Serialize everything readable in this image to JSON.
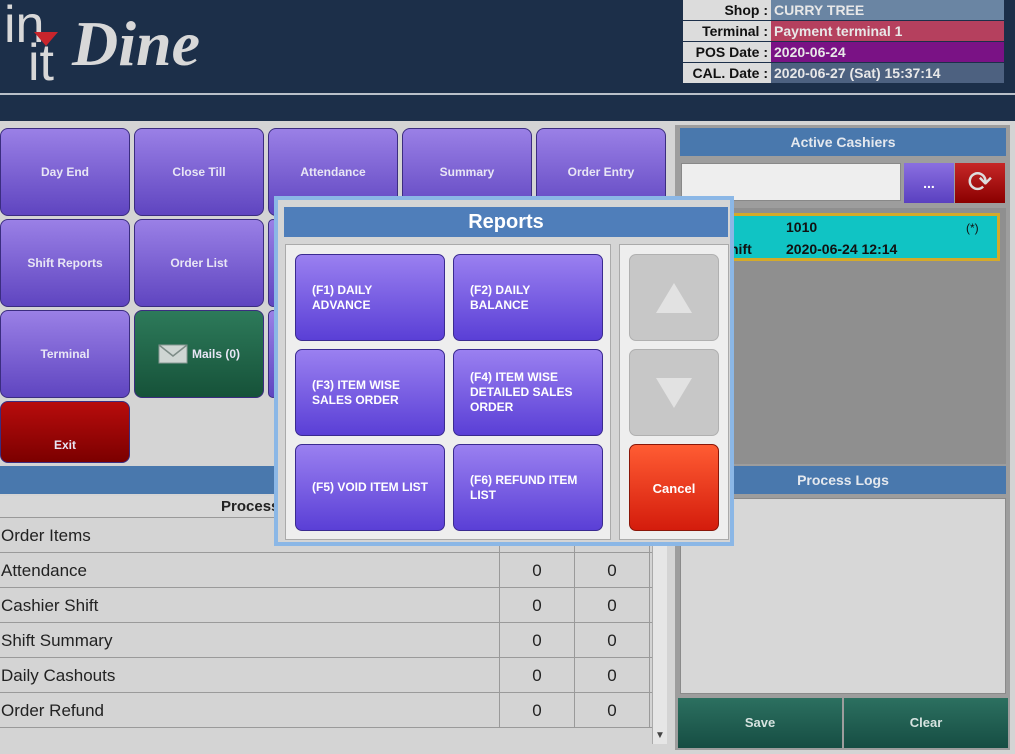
{
  "logo": {
    "in": "in",
    "it": "it",
    "dine": "Dine"
  },
  "info": {
    "shop_label": "Shop :",
    "shop_value": "CURRY TREE",
    "terminal_label": "Terminal :",
    "terminal_value": "Payment terminal 1",
    "posdate_label": "POS Date :",
    "posdate_value": "2020-06-24",
    "caldate_label": "CAL. Date :",
    "caldate_value": "2020-06-27 (Sat) 15:37:14",
    "colors": {
      "shop": "#6a85a3",
      "terminal": "#b5405e",
      "posdate": "#7a1285",
      "caldate": "#4d6180"
    }
  },
  "tiles": {
    "day_end": "Day End",
    "close_till": "Close Till",
    "attendance": "Attendance",
    "summary": "Summary",
    "order_entry": "Order Entry",
    "shift_reports": "Shift Reports",
    "order_list": "Order List",
    "terminal": "Terminal",
    "mails": "Mails (0)",
    "exit": "Exit"
  },
  "table": {
    "header": "Process",
    "rows": [
      {
        "name": "Order Items",
        "a": "",
        "b": ""
      },
      {
        "name": "Attendance",
        "a": "0",
        "b": "0"
      },
      {
        "name": "Cashier Shift",
        "a": "0",
        "b": "0"
      },
      {
        "name": "Shift Summary",
        "a": "0",
        "b": "0"
      },
      {
        "name": "Daily Cashouts",
        "a": "0",
        "b": "0"
      },
      {
        "name": "Order Refund",
        "a": "0",
        "b": "0"
      }
    ]
  },
  "cashiers": {
    "title": "Active Cashiers",
    "dots": "...",
    "card": {
      "id": "1010",
      "star": "(*)",
      "shift": "hift",
      "date": "2020-06-24 12:14"
    }
  },
  "logs": {
    "title": "Process Logs",
    "save": "Save",
    "clear": "Clear"
  },
  "modal": {
    "title": "Reports",
    "buttons": [
      "(F1) DAILY ADVANCE",
      "(F2) DAILY BALANCE",
      "(F3) ITEM WISE SALES ORDER",
      "(F4) ITEM WISE DETAILED SALES ORDER",
      "(F5) VOID ITEM LIST",
      "(F6) REFUND ITEM LIST"
    ],
    "cancel": "Cancel"
  }
}
